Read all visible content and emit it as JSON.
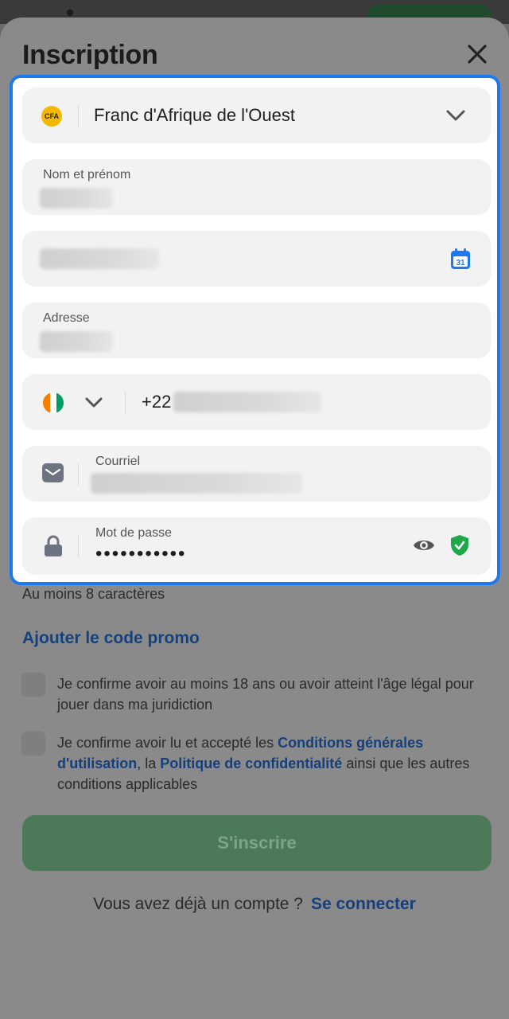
{
  "header": {
    "title": "Inscription"
  },
  "form": {
    "currency": {
      "badge": "CFA",
      "value": "Franc d'Afrique de l'Ouest"
    },
    "name": {
      "label": "Nom et prénom"
    },
    "birthdate": {
      "calendar_day": "31"
    },
    "address": {
      "label": "Adresse"
    },
    "phone": {
      "prefix": "+22"
    },
    "email": {
      "label": "Courriel"
    },
    "password": {
      "label": "Mot de passe",
      "masked": "•••••••••••",
      "hint": "Au moins 8 caractères"
    }
  },
  "promo_link": "Ajouter le code promo",
  "consents": [
    {
      "text": "Je confirme avoir au moins 18 ans ou avoir atteint l'âge légal pour jouer dans ma juridiction"
    },
    {
      "prefix": "Je confirme avoir lu et accepté les ",
      "terms_link": "Conditions générales d'utilisation",
      "middle": ", la ",
      "privacy_link": "Politique de confidentialité",
      "suffix": " ainsi que les autres conditions applicables"
    }
  ],
  "submit_label": "S'inscrire",
  "login": {
    "question": "Vous avez déjà un compte ?",
    "link": "Se connecter"
  },
  "colors": {
    "accent": "#1e78f0",
    "primary_disabled": "#4c7a58",
    "link": "#14427e",
    "shield": "#1fa84a"
  }
}
